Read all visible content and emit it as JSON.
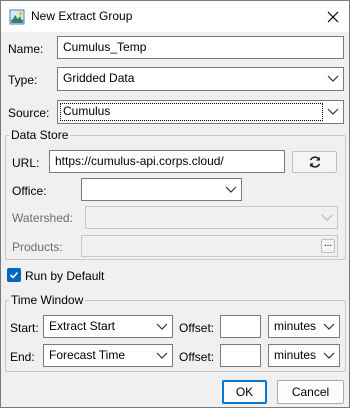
{
  "window": {
    "title": "New Extract Group",
    "icons": {
      "app": "app-icon",
      "close": "close-icon"
    }
  },
  "form": {
    "name_label": "Name:",
    "name_value": "Cumulus_Temp",
    "type_label": "Type:",
    "type_value": "Gridded Data",
    "source_label": "Source:",
    "source_value": "Cumulus"
  },
  "data_store": {
    "title": "Data Store",
    "url_label": "URL:",
    "url_value": "https://cumulus-api.corps.cloud/",
    "refresh_icon": "refresh-icon",
    "office_label": "Office:",
    "office_value": "",
    "watershed_label": "Watershed:",
    "watershed_value": "",
    "products_label": "Products:",
    "products_value": "",
    "browse_label": "..."
  },
  "run_by_default": {
    "label": "Run by Default",
    "checked": true
  },
  "time_window": {
    "title": "Time Window",
    "start_label": "Start:",
    "start_value": "Extract Start",
    "start_offset_label": "Offset:",
    "start_offset_value": "",
    "start_unit": "minutes",
    "end_label": "End:",
    "end_value": "Forecast Time",
    "end_offset_label": "Offset:",
    "end_offset_value": "",
    "end_unit": "minutes"
  },
  "buttons": {
    "ok": "OK",
    "cancel": "Cancel"
  },
  "colors": {
    "accent": "#0078d4",
    "checkbox": "#0067c0",
    "dialog_bg": "#f0f0f0"
  }
}
